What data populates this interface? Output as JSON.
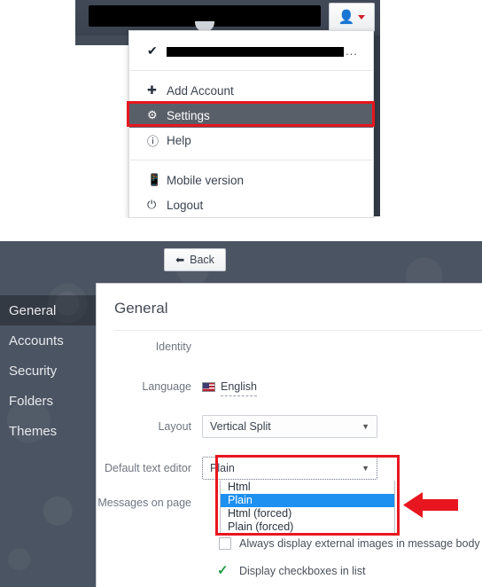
{
  "top_screenshot": {
    "search_field": {
      "name": "search-input",
      "value": "",
      "redacted": true
    },
    "user_button": {
      "icon": "user-icon",
      "caret": "chevron-down-icon"
    },
    "account_menu": {
      "account_item": {
        "check_icon": "check-icon",
        "email": "",
        "ellipsis": "..."
      },
      "items": [
        {
          "label": "Add Account",
          "icon": "plus-icon",
          "active": false
        },
        {
          "label": "Settings",
          "icon": "gear-icon",
          "active": true
        },
        {
          "label": "Help",
          "icon": "question-circle-icon",
          "active": false
        },
        {
          "label": "Mobile version",
          "icon": "mobile-icon",
          "active": false
        },
        {
          "label": "Logout",
          "icon": "power-icon",
          "active": false
        }
      ]
    },
    "annotation": {
      "type": "red-rectangle",
      "target": "Settings",
      "color": "#e8161f"
    }
  },
  "bottom_screenshot": {
    "back_button": {
      "label": "Back",
      "icon": "arrow-left-icon"
    },
    "sidebar": {
      "items": [
        {
          "label": "General",
          "active": true
        },
        {
          "label": "Accounts",
          "active": false
        },
        {
          "label": "Security",
          "active": false
        },
        {
          "label": "Folders",
          "active": false
        },
        {
          "label": "Themes",
          "active": false
        }
      ]
    },
    "panel": {
      "title": "General",
      "fields": {
        "identity": {
          "label": "Identity",
          "value": "",
          "redacted": true
        },
        "language": {
          "label": "Language",
          "value": "English",
          "flag": "us-flag-icon"
        },
        "layout": {
          "label": "Layout",
          "value": "Vertical Split",
          "caret": "chevron-down-icon"
        },
        "default_text_editor": {
          "label": "Default text editor",
          "value": "Plain",
          "caret": "chevron-down-icon",
          "open": true,
          "options": [
            {
              "label": "Html",
              "selected": false
            },
            {
              "label": "Plain",
              "selected": true
            },
            {
              "label": "Html (forced)",
              "selected": false
            },
            {
              "label": "Plain (forced)",
              "selected": false
            }
          ]
        },
        "messages_on_page": {
          "label": "Messages on page",
          "value": ""
        }
      },
      "checkboxes": [
        {
          "label": "Always display external images in message body",
          "checked": false
        },
        {
          "label": "Display checkboxes in list",
          "checked": true
        }
      ]
    },
    "annotations": {
      "dropdown_box": {
        "type": "red-rectangle",
        "color": "#e8161f"
      },
      "arrow": {
        "type": "red-arrow-left",
        "color": "#e8161f"
      }
    }
  },
  "colors": {
    "accent_red": "#e8161f",
    "selection_blue": "#1e90f0",
    "dark_chrome": "#3d4450",
    "page_background": "#4b5462",
    "check_green": "#1e9e42",
    "user_icon_red": "#cf2027"
  }
}
